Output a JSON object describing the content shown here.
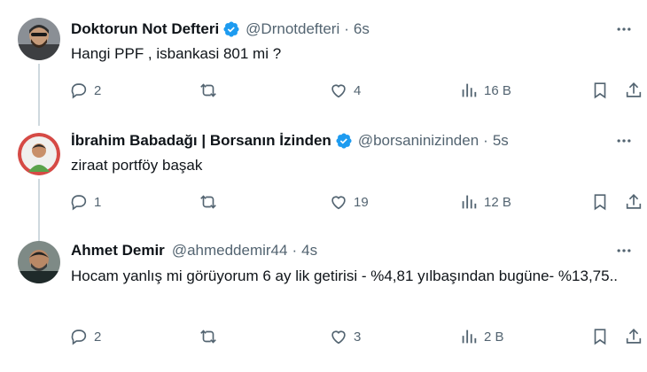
{
  "colors": {
    "verified": "#1d9bf0",
    "text": "#0f1419",
    "muted": "#536471",
    "thread": "#cfd9de"
  },
  "tweets": [
    {
      "name": "Doktorun Not Defteri",
      "handle": "@Drnotdefteri",
      "dot": "·",
      "time": "6s",
      "text": "Hangi PPF , isbankasi 801 mi ?",
      "replies": "2",
      "retweets": "",
      "likes": "4",
      "views": "16 B"
    },
    {
      "name": "İbrahim Babadağı | Borsanın İzinden",
      "handle": "@borsaninizinden",
      "dot": "·",
      "time": "5s",
      "text": "ziraat portföy başak",
      "replies": "1",
      "retweets": "",
      "likes": "19",
      "views": "12 B"
    },
    {
      "name": "Ahmet Demir",
      "handle": "@ahmeddemir44",
      "dot": "·",
      "time": "4s",
      "text": "Hocam yanlış mi görüyorum 6 ay lik getirisi - %4,81 yılbaşından bugüne- %13,75..",
      "replies": "2",
      "retweets": "",
      "likes": "3",
      "views": "2 B"
    }
  ]
}
